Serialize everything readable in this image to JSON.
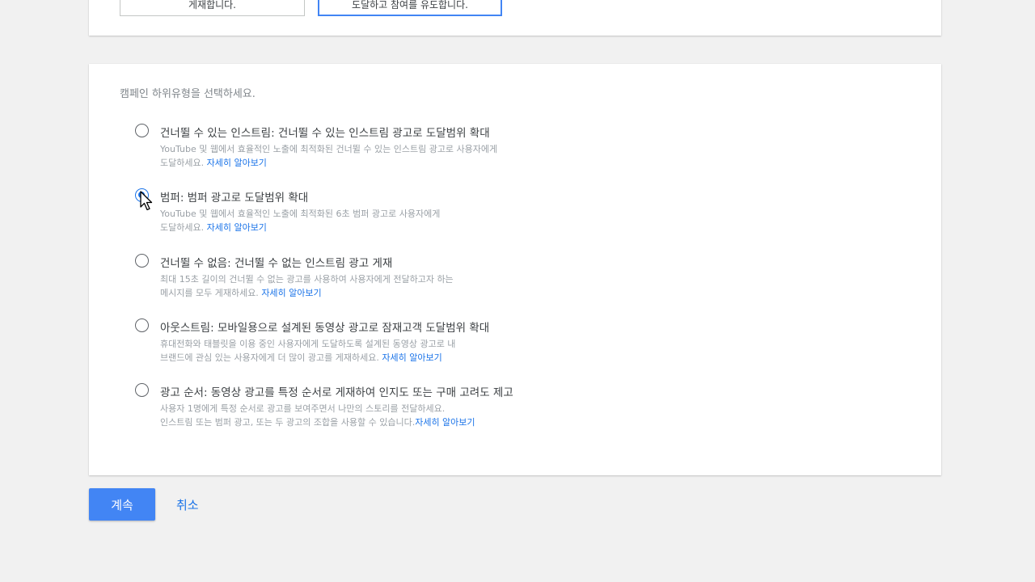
{
  "goal_cards": [
    {
      "text": "게재합니다."
    },
    {
      "text": "도달하고 참여를 유도합니다."
    }
  ],
  "subtype_section": {
    "subtitle": "캠페인 하위유형을 선택하세요.",
    "selected_index": 1,
    "options": [
      {
        "title": "건너뛸 수 있는 인스트림: 건너뛸 수 있는 인스트림 광고로 도달범위 확대",
        "desc_1": "YouTube 및 웹에서 효율적인 노출에 최적화된 건너뛸 수 있는 인스트림 광고로 사용자에게",
        "desc_2": "도달하세요. ",
        "learn_more": "자세히 알아보기"
      },
      {
        "title": "범퍼: 범퍼 광고로 도달범위 확대",
        "desc_1": "YouTube 및 웹에서 효율적인 노출에 최적화된 6초 범퍼 광고로 사용자에게",
        "desc_2": "도달하세요. ",
        "learn_more": "자세히 알아보기"
      },
      {
        "title": "건너뛸 수 없음: 건너뛸 수 없는 인스트림 광고 게재",
        "desc_1": "최대 15초 길이의 건너뛸 수 없는 광고를 사용하여 사용자에게 전달하고자 하는",
        "desc_2": "메시지를 모두 게재하세요. ",
        "learn_more": "자세히 알아보기"
      },
      {
        "title": "아웃스트림: 모바일용으로 설계된 동영상 광고로 잠재고객 도달범위 확대",
        "desc_1": "휴대전화와 태블릿을 이용 중인 사용자에게 도달하도록 설계된 동영상 광고로 내",
        "desc_2": "브랜드에 관심 있는 사용자에게 더 많이 광고를 게재하세요. ",
        "learn_more": "자세히 알아보기"
      },
      {
        "title": "광고 순서: 동영상 광고를 특정 순서로 게재하여 인지도 또는 구매 고려도 제고",
        "desc_1": "사용자 1명에게 특정 순서로 광고를 보여주면서 나만의 스토리를 전달하세요.",
        "desc_2": "인스트림 또는 범퍼 광고, 또는 두 광고의 조합을 사용할 수 있습니다.",
        "learn_more": "자세히 알아보기"
      }
    ]
  },
  "actions": {
    "continue_label": "계속",
    "cancel_label": "취소"
  },
  "colors": {
    "accent": "#4285f4",
    "link": "#1a73e8",
    "background": "#f1f1f1"
  }
}
